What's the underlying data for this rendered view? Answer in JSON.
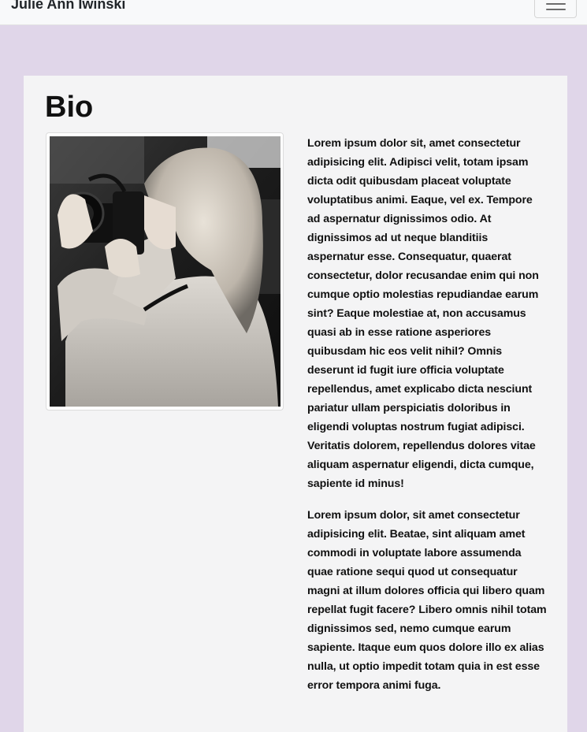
{
  "navbar": {
    "brand": "Julie Ann Iwinski",
    "toggle_icon": "hamburger-menu-icon"
  },
  "bio": {
    "title": "Bio",
    "photo_alt": "photographer-image",
    "paragraphs": [
      "Lorem ipsum dolor sit, amet consectetur adipisicing elit. Adipisci velit, totam ipsam dicta odit quibusdam placeat voluptate voluptatibus animi. Eaque, vel ex. Tempore ad aspernatur dignissimos odio. At dignissimos ad ut neque blanditiis aspernatur esse. Consequatur, quaerat consectetur, dolor recusandae enim qui non cumque optio molestias repudiandae earum sint? Eaque molestiae at, non accusamus quasi ab in esse ratione asperiores quibusdam hic eos velit nihil? Omnis deserunt id fugit iure officia voluptate repellendus, amet explicabo dicta nesciunt pariatur ullam perspiciatis doloribus in eligendi voluptas nostrum fugiat adipisci. Veritatis dolorem, repellendus dolores vitae aliquam aspernatur eligendi, dicta cumque, sapiente id minus!",
      "Lorem ipsum dolor, sit amet consectetur adipisicing elit. Beatae, sint aliquam amet commodi in voluptate labore assumenda quae ratione sequi quod ut consequatur magni at illum dolores officia qui libero quam repellat fugit facere? Libero omnis nihil totam dignissimos sed, nemo cumque earum sapiente. Itaque eum quos dolore illo ex alias nulla, ut optio impedit totam quia in est esse error tempora animi fuga."
    ]
  },
  "colors": {
    "page_background": "#e0d6e9",
    "card_background": "#f4f4f5",
    "navbar_background": "#f8f9fa"
  }
}
